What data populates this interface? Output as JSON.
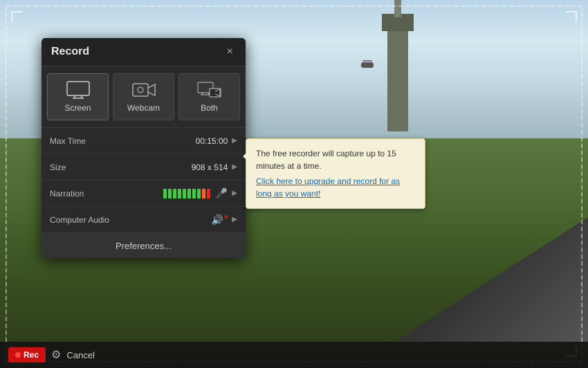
{
  "dialog": {
    "title": "Record",
    "close_label": "×"
  },
  "modes": [
    {
      "id": "screen",
      "label": "Screen",
      "active": true
    },
    {
      "id": "webcam",
      "label": "Webcam",
      "active": false
    },
    {
      "id": "both",
      "label": "Both",
      "active": false
    }
  ],
  "settings": [
    {
      "label": "Max Time",
      "value": "00:15:00"
    },
    {
      "label": "Size",
      "value": "908 x 514"
    },
    {
      "label": "Narration",
      "value": ""
    },
    {
      "label": "Computer Audio",
      "value": ""
    }
  ],
  "preferences_label": "Preferences...",
  "tooltip": {
    "text": "The free recorder will capture up to 15 minutes at a time.",
    "link_text": "Click here to upgrade and record for as long as you want!"
  },
  "bottom_bar": {
    "rec_label": "Rec",
    "cancel_label": "Cancel"
  }
}
